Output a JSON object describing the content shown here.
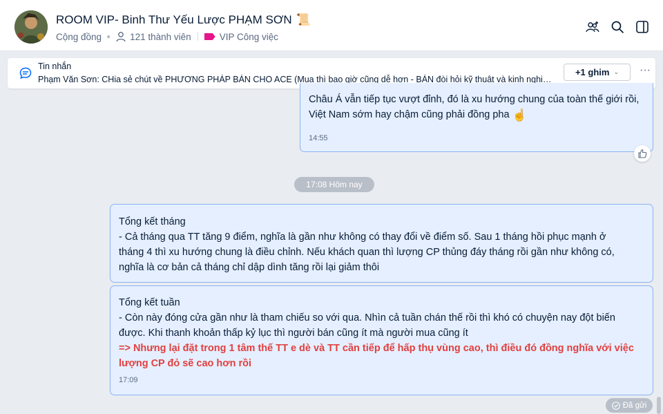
{
  "header": {
    "title": "ROOM VIP- Binh Thư Yếu Lược PHẠM SƠN",
    "title_emoji": "📜",
    "type": "Cộng đồng",
    "members": "121 thành viên",
    "tag": "VIP Công việc"
  },
  "pinned": {
    "label": "Tin nhắn",
    "text": "Phạm Văn Sơn: CHia sẻ chút về PHƯƠNG PHÁP BÁN CHO ACE (Mua thì bao giờ cũng dễ hơn - BÁN đòi hỏi kỹ thuật và kinh nghiệm...",
    "more_pins": "+1 ghim"
  },
  "messages": [
    {
      "text": "Châu Á vẫn tiếp tục vượt đỉnh, đó là xu hướng chung của toàn thế giới rồi, Việt Nam sớm hay chậm cũng phải đồng pha",
      "emoji": "☝",
      "time": "14:55"
    },
    {
      "heading": "Tổng kết tháng",
      "lines": [
        "- Cả tháng qua TT tăng 9 điểm, nghĩa là gần như không có thay đổi về điểm số. Sau 1 tháng hồi phục mạnh ở",
        "tháng 4 thì xu hướng chung là điều chỉnh. Nếu khách quan thì lượng CP thủng đáy tháng rồi gần như không có,",
        "nghĩa là cơ bản cả tháng chỉ dập dình tăng rồi lại giảm thôi"
      ]
    },
    {
      "heading": "Tổng kết tuần",
      "lines": [
        "- Còn này đóng cửa gần như là tham chiếu so với qua. Nhìn cả tuần chán thế rồi thì khó có chuyện nay đột biến",
        "được. Khi thanh khoản thấp kỷ lục thì người bán cũng ít mà người mua cũng ít"
      ],
      "highlight_lines": [
        "=> Nhưng lại đặt trong 1 tâm thế TT e dè và TT cần tiếp để hấp thụ vùng cao, thì điều đó đồng nghĩa với việc",
        "lượng CP đỏ sẽ cao hơn rồi"
      ],
      "time": "17:09"
    }
  ],
  "date_divider": "17:08 Hôm nay",
  "status": "Đã gửi",
  "colors": {
    "bubble_bg": "#e5efff",
    "bubble_border": "#8ab4f0",
    "highlight": "#e23f3f",
    "tag": "#e7158b"
  },
  "icons": {
    "add_member": "add-member-icon",
    "search": "search-icon",
    "layout": "sidebar-toggle-icon",
    "pinned": "message-icon",
    "more": "more-horizontal-icon",
    "like": "thumbs-up-icon",
    "sent": "check-icon"
  }
}
